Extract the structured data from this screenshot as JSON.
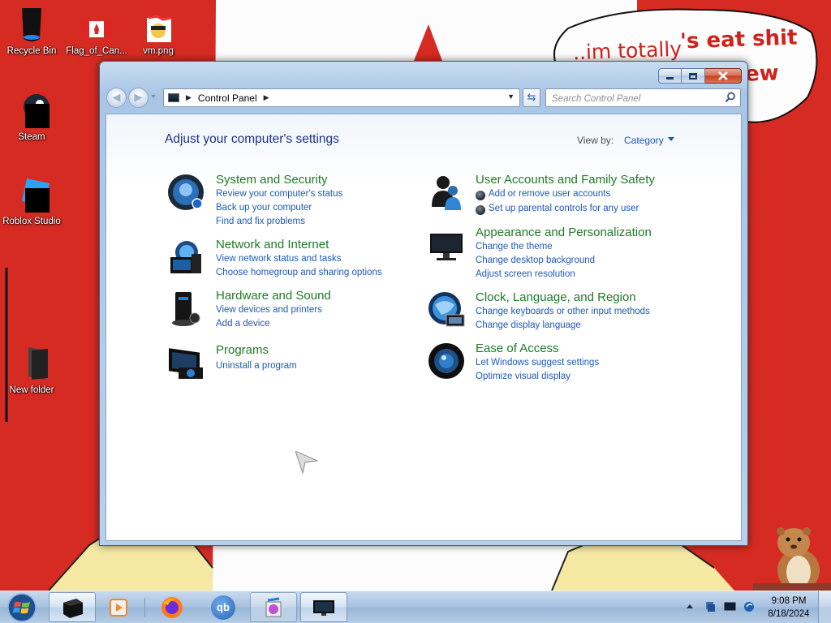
{
  "desktop": {
    "speech_text_1": "..im totally",
    "speech_text_2": "'s eat shit",
    "speech_text_3": "ew",
    "icons": [
      {
        "label": "Recycle Bin",
        "icon": "recycle-bin-icon"
      },
      {
        "label": "Flag_of_Can...",
        "icon": "canada-flag-image-icon"
      },
      {
        "label": "vm.png",
        "icon": "image-file-icon"
      },
      {
        "label": "Steam",
        "icon": "steam-icon"
      },
      {
        "label": "Roblox Studio",
        "icon": "roblox-studio-icon"
      },
      {
        "label": "New folder",
        "icon": "folder-icon"
      }
    ]
  },
  "window": {
    "address": {
      "segment": "Control Panel"
    },
    "search": {
      "placeholder": "Search Control Panel"
    },
    "heading": "Adjust your computer's settings",
    "view_by_label": "View by:",
    "view_by_value": "Category",
    "categories_left": [
      {
        "title": "System and Security",
        "icon": "system-security-icon",
        "links": [
          "Review your computer's status",
          "Back up your computer",
          "Find and fix problems"
        ]
      },
      {
        "title": "Network and Internet",
        "icon": "network-internet-icon",
        "links": [
          "View network status and tasks",
          "Choose homegroup and sharing options"
        ]
      },
      {
        "title": "Hardware and Sound",
        "icon": "hardware-sound-icon",
        "links": [
          "View devices and printers",
          "Add a device"
        ]
      },
      {
        "title": "Programs",
        "icon": "programs-icon",
        "links": [
          "Uninstall a program"
        ]
      }
    ],
    "categories_right": [
      {
        "title": "User Accounts and Family Safety",
        "icon": "user-accounts-icon",
        "links": [
          "Add or remove user accounts",
          "Set up parental controls for any user"
        ]
      },
      {
        "title": "Appearance and Personalization",
        "icon": "appearance-icon",
        "links": [
          "Change the theme",
          "Change desktop background",
          "Adjust screen resolution"
        ]
      },
      {
        "title": "Clock, Language, and Region",
        "icon": "clock-language-region-icon",
        "links": [
          "Change keyboards or other input methods",
          "Change display language"
        ]
      },
      {
        "title": "Ease of Access",
        "icon": "ease-of-access-icon",
        "links": [
          "Let Windows suggest settings",
          "Optimize visual display"
        ]
      }
    ]
  },
  "taskbar": {
    "items": [
      {
        "icon": "black-app-icon"
      },
      {
        "icon": "media-player-icon"
      },
      {
        "icon": "firefox-icon"
      },
      {
        "icon": "qbittorrent-icon"
      },
      {
        "icon": "media-center-icon"
      },
      {
        "icon": "control-panel-icon"
      }
    ],
    "qb_text": "qb",
    "clock": {
      "time": "9:08 PM",
      "date": "8/18/2024"
    }
  },
  "colors": {
    "title_green": "#1e7a26",
    "link_blue": "#1e58b4",
    "heading_blue": "#1e3287",
    "wallpaper_red": "#d62b22"
  }
}
